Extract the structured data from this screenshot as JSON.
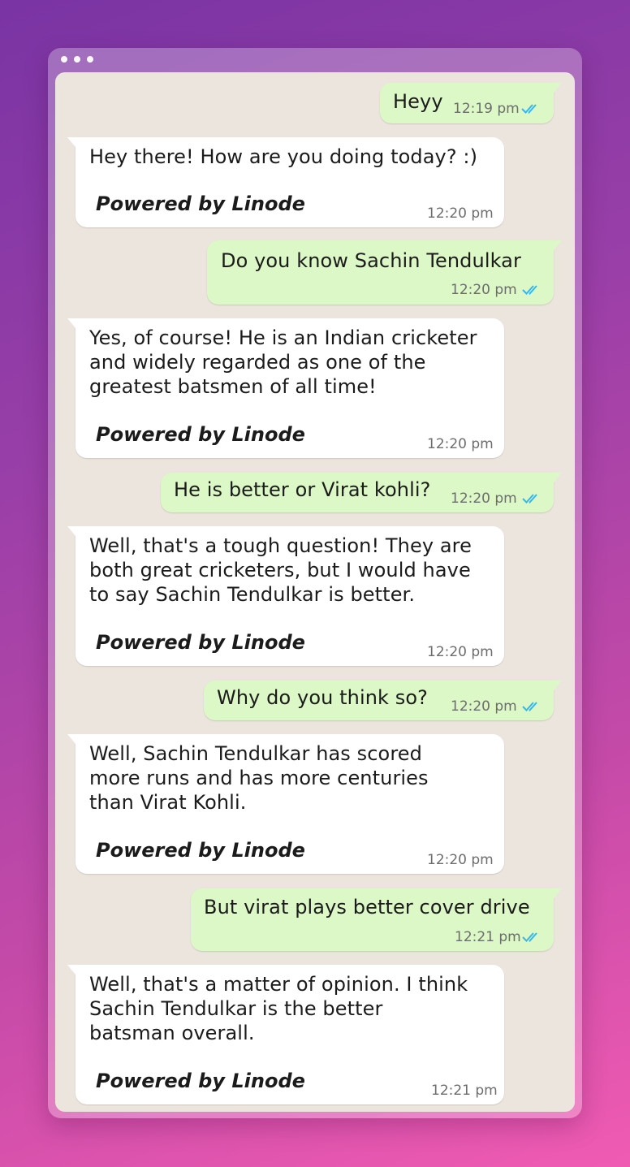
{
  "window": {
    "dots": [
      "•",
      "•",
      "•"
    ]
  },
  "colors": {
    "sent_bubble": "#dcf8c6",
    "received_bubble": "#ffffff",
    "read_ticks": "#34b7f1",
    "chat_background": "#ece5dd"
  },
  "messages": [
    {
      "direction": "sent",
      "text": "Heyy",
      "time": "12:19 pm",
      "status_icon": "double-check-read-icon"
    },
    {
      "direction": "received",
      "lines": [
        "Hey there! How are you doing today? :)"
      ],
      "footer": "Powered by Linode",
      "time": "12:20 pm"
    },
    {
      "direction": "sent",
      "text": "Do you know Sachin Tendulkar",
      "time": "12:20 pm",
      "status_icon": "double-check-read-icon"
    },
    {
      "direction": "received",
      "lines": [
        "Yes, of course! He is an Indian cricketer",
        "and widely regarded as one of the",
        "greatest batsmen of all time!"
      ],
      "footer": "Powered by Linode",
      "time": "12:20 pm"
    },
    {
      "direction": "sent",
      "text": "He is better or Virat kohli?",
      "time": "12:20 pm",
      "status_icon": "double-check-read-icon"
    },
    {
      "direction": "received",
      "lines": [
        "Well, that's a tough question! They are",
        "both great cricketers, but I would have",
        "to say Sachin Tendulkar is better."
      ],
      "footer": "Powered by Linode",
      "time": "12:20 pm"
    },
    {
      "direction": "sent",
      "text": "Why do you think so?",
      "time": "12:20 pm",
      "status_icon": "double-check-read-icon"
    },
    {
      "direction": "received",
      "lines": [
        "Well, Sachin Tendulkar has scored",
        "more runs and has more centuries",
        "than Virat Kohli."
      ],
      "footer": "Powered by Linode",
      "time": "12:20 pm"
    },
    {
      "direction": "sent",
      "text": "But virat plays better cover drive",
      "time": "12:21 pm",
      "status_icon": "double-check-read-icon"
    },
    {
      "direction": "received",
      "lines": [
        "Well, that's a matter of opinion. I think",
        "Sachin Tendulkar is the better",
        "batsman overall."
      ],
      "footer": "Powered by Linode",
      "time": "12:21 pm"
    }
  ]
}
